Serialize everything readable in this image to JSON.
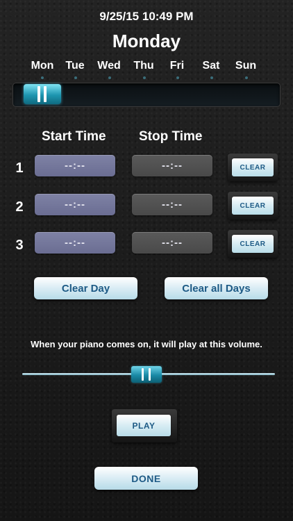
{
  "header": {
    "datetime": "9/25/15 10:49 PM",
    "day_title": "Monday"
  },
  "days": [
    "Mon",
    "Tue",
    "Wed",
    "Thu",
    "Fri",
    "Sat",
    "Sun"
  ],
  "day_slider": {
    "selected": "Mon"
  },
  "columns": {
    "start": "Start Time",
    "stop": "Stop Time"
  },
  "rows": [
    {
      "number": "1",
      "start": "--:--",
      "stop": "--:--",
      "clear_label": "CLEAR"
    },
    {
      "number": "2",
      "start": "--:--",
      "stop": "--:--",
      "clear_label": "CLEAR"
    },
    {
      "number": "3",
      "start": "--:--",
      "stop": "--:--",
      "clear_label": "CLEAR"
    }
  ],
  "actions": {
    "clear_day": "Clear Day",
    "clear_all_days": "Clear all Days"
  },
  "volume": {
    "message": "When your piano comes on, it will play at this volume.",
    "level": 0.5
  },
  "play_label": "PLAY",
  "done_label": "DONE",
  "colors": {
    "accent": "#1e96b0",
    "button_text": "#1d5a85",
    "start_box": "#7f82a5",
    "stop_box": "#5a5a5a"
  }
}
